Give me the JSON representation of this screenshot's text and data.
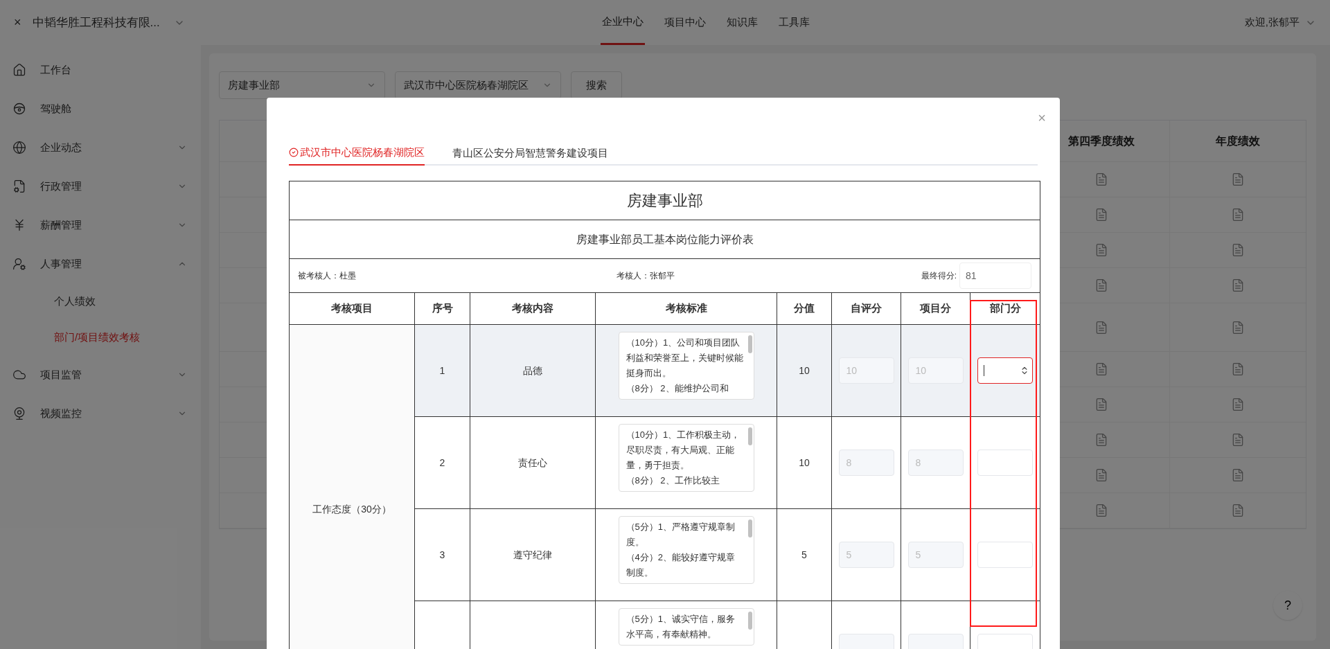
{
  "header": {
    "close": "×",
    "company": "中韬华胜工程科技有限...",
    "nav": [
      {
        "label": "企业中心",
        "selected": true
      },
      {
        "label": "项目中心",
        "selected": false
      },
      {
        "label": "知识库",
        "selected": false
      },
      {
        "label": "工具库",
        "selected": false
      }
    ],
    "welcome": "欢迎,张郁平"
  },
  "sidebar": {
    "items": [
      {
        "label": "工作台",
        "selected": false
      },
      {
        "label": "驾驶舱",
        "selected": false
      },
      {
        "label": "企业动态",
        "expanded": false,
        "selected": false
      },
      {
        "label": "行政管理",
        "expanded": false,
        "selected": false
      },
      {
        "label": "薪酬管理",
        "expanded": false,
        "selected": false
      },
      {
        "label": "人事管理",
        "expanded": true,
        "selected": false,
        "children": [
          {
            "label": "个人绩效",
            "selected": false
          },
          {
            "label": "部门/项目绩效考核",
            "selected": true
          }
        ]
      },
      {
        "label": "项目监管",
        "expanded": false,
        "selected": false
      },
      {
        "label": "视频监控",
        "expanded": false,
        "selected": false
      }
    ]
  },
  "filters": {
    "department": "房建事业部",
    "project": "武汉市中心医院杨春湖院区",
    "search_button": "搜索"
  },
  "background_table": {
    "columns": [
      "第四季度绩效",
      "年度绩效"
    ],
    "row_count_tall": [
      false,
      false,
      false,
      false,
      true,
      false,
      false,
      false,
      false,
      false
    ]
  },
  "help_button": "?",
  "dialog": {
    "close": "×",
    "tabs": [
      {
        "label": "武汉市中心医院杨春湖院区",
        "selected": true
      },
      {
        "label": "青山区公安分局智慧警务建设项目",
        "selected": false
      }
    ],
    "form": {
      "title": "房建事业部",
      "subtitle": "房建事业部员工基本岗位能力评价表",
      "assessee": "被考核人：杜墨",
      "assessor": "考核人：张郁平",
      "final_score_label": "最终得分:",
      "final_score": "81",
      "columns": [
        "考核项目",
        "序号",
        "考核内容",
        "考核标准",
        "分值",
        "自评分",
        "项目分",
        "部门分"
      ],
      "group": "工作态度（30分）",
      "rows": [
        {
          "no": "1",
          "item": "品德",
          "standard": [
            "（10分）1、公司和项目团队利益和荣誉至上，关键时候能挺身而出。",
            "（8分） 2、能维护公司和"
          ],
          "score": "10",
          "self_score": "10",
          "project_score": "10",
          "dept_focused": true,
          "shaded": true
        },
        {
          "no": "2",
          "item": "责任心",
          "standard": [
            "（10分）1、工作积极主动，尽职尽责，有大局观、正能量，勇于担责。",
            "（8分） 2、工作比较主"
          ],
          "score": "10",
          "self_score": "8",
          "project_score": "8",
          "dept_focused": false,
          "shaded": false
        },
        {
          "no": "3",
          "item": "遵守纪律",
          "standard": [
            "（5分）1、严格遵守规章制度。",
            "（4分）2、能较好遵守规章制度。"
          ],
          "score": "5",
          "self_score": "5",
          "project_score": "5",
          "dept_focused": false,
          "shaded": false
        },
        {
          "standard": [
            "（5分）1、诚实守信，服务水平高，有奉献精神。"
          ],
          "dept_focused": false,
          "shaded": false
        }
      ]
    }
  }
}
